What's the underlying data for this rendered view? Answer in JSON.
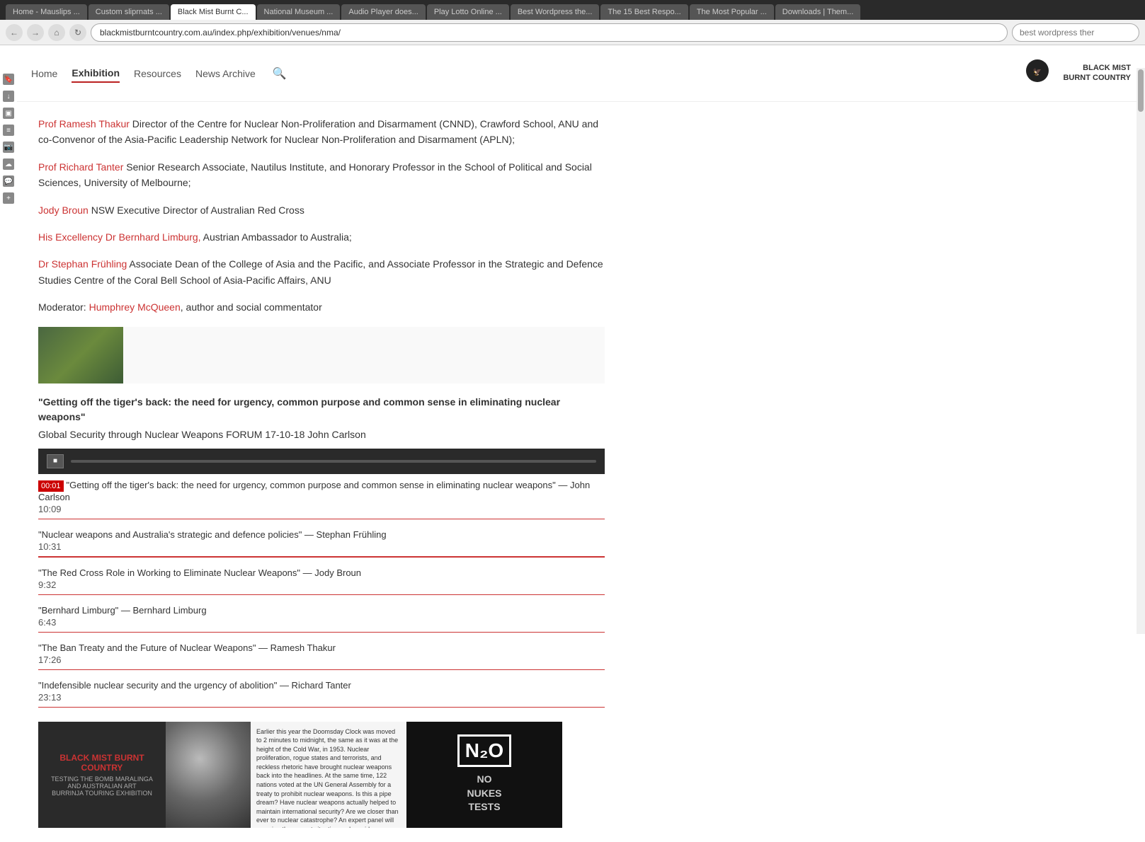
{
  "browser": {
    "address": "blackmistburntcountry.com.au/index.php/exhibition/venues/nma/",
    "search_placeholder": "best wordpress ther",
    "tabs": [
      {
        "label": "Home - Mauslips ...",
        "active": false
      },
      {
        "label": "Custom sliprnats ...",
        "active": false
      },
      {
        "label": "Black Mist Burnt C...",
        "active": true
      },
      {
        "label": "National Museum ...",
        "active": false
      },
      {
        "label": "Audio Player does...",
        "active": false
      },
      {
        "label": "Play Lotto Online ...",
        "active": false
      },
      {
        "label": "Best Wordpress the...",
        "active": false
      },
      {
        "label": "The 15 Best Respo...",
        "active": false
      },
      {
        "label": "The Most Popular ...",
        "active": false
      },
      {
        "label": "Downloads | Them...",
        "active": false
      }
    ]
  },
  "nav": {
    "home": "Home",
    "exhibition": "Exhibition",
    "resources": "Resources",
    "news_archive": "News Archive",
    "logo_line1": "BLACK MIST",
    "logo_line2": "BURNT COUNTRY"
  },
  "people": [
    {
      "name": "Prof Ramesh Thakur",
      "description": "Director of the Centre for Nuclear Non-Proliferation and Disarmament (CNND), Crawford School, ANU and co-Convenor of the Asia-Pacific Leadership Network for Nuclear Non-Proliferation and Disarmament (APLN);"
    },
    {
      "name": "Prof Richard Tanter",
      "description": "Senior Research Associate, Nautilus Institute, and Honorary Professor in the School of Political and Social Sciences, University of Melbourne;"
    },
    {
      "name": "Jody Broun",
      "description": "NSW Executive Director of Australian Red Cross"
    },
    {
      "name": "His Excellency Dr Bernhard Limburg,",
      "description": "Austrian Ambassador to Australia;"
    },
    {
      "name": "Dr Stephan Frühling",
      "description": "Associate Dean of the College of Asia and the Pacific, and Associate Professor in the Strategic and Defence Studies Centre of the Coral Bell School of Asia-Pacific Affairs, ANU"
    }
  ],
  "moderator": {
    "label": "Moderator:",
    "name": "Humphrey McQueen",
    "description": ", author and social commentator"
  },
  "main_quote": {
    "title": "\"Getting off the tiger's back: the need for urgency, common purpose and common sense in eliminating nuclear weapons\"",
    "subtitle": "Global Security through Nuclear Weapons FORUM 17-10-18 John Carlson"
  },
  "audio_player": {
    "now_playing": "\"Getting off the tiger's back: the need for urgency, common purpose and common sense in eliminating nuclear weapons\" — John Carlson",
    "current_time": "00:01"
  },
  "tracks": [
    {
      "title": "\"Getting off the tiger's back: the need for urgency, common purpose and common sense in eliminating nuclear weapons\" — John Carlson",
      "duration": "10:09",
      "is_current": true,
      "has_red_border": false
    },
    {
      "title": "\"Nuclear weapons and Australia's strategic and defence policies\" — Stephan Frühling",
      "duration": "10:31",
      "is_current": false,
      "has_red_border": true
    },
    {
      "title": "\"The Red Cross Role in Working to Eliminate Nuclear Weapons\" — Jody Broun",
      "duration": "9:32",
      "is_current": false,
      "has_red_border": false
    },
    {
      "title": "\"Bernhard Limburg\" — Bernhard Limburg",
      "duration": "6:43",
      "is_current": false,
      "has_red_border": false
    },
    {
      "title": "\"The Ban Treaty and the Future of Nuclear Weapons\" — Ramesh Thakur",
      "duration": "17:26",
      "is_current": false,
      "has_red_border": false
    },
    {
      "title": "\"Indefensible nuclear security and the urgency of abolition\" — Richard Tanter",
      "duration": "23:13",
      "is_current": false,
      "has_red_border": false
    }
  ],
  "bottom_text": {
    "content": "Earlier this year the Doomsday Clock was moved to 2 minutes to midnight, the same as it was at the height of the Cold War, in 1953. Nuclear proliferation, rogue states and terrorists, and reckless rhetoric have brought nuclear weapons back into the headlines. At the same time, 122 nations voted at the UN General Assembly for a treaty to prohibit nuclear weapons. Is this a pipe dream? Have nuclear weapons actually helped to maintain international security? Are we closer than ever to nuclear catastrophe? An expert panel will examine the current situation and provide an outlook."
  },
  "bottom_logo": {
    "brand": "BLACK MIST BURNT COUNTRY",
    "subtitle": "TESTING THE BOMB  MARALINGA AND AUSTRALIAN ART",
    "subtitle2": "BURRINJA TOURING EXHIBITION"
  },
  "nuke_sign": {
    "line1": "N₂O",
    "line2": "NO",
    "line3": "NUKES",
    "line4": "TESTS"
  }
}
